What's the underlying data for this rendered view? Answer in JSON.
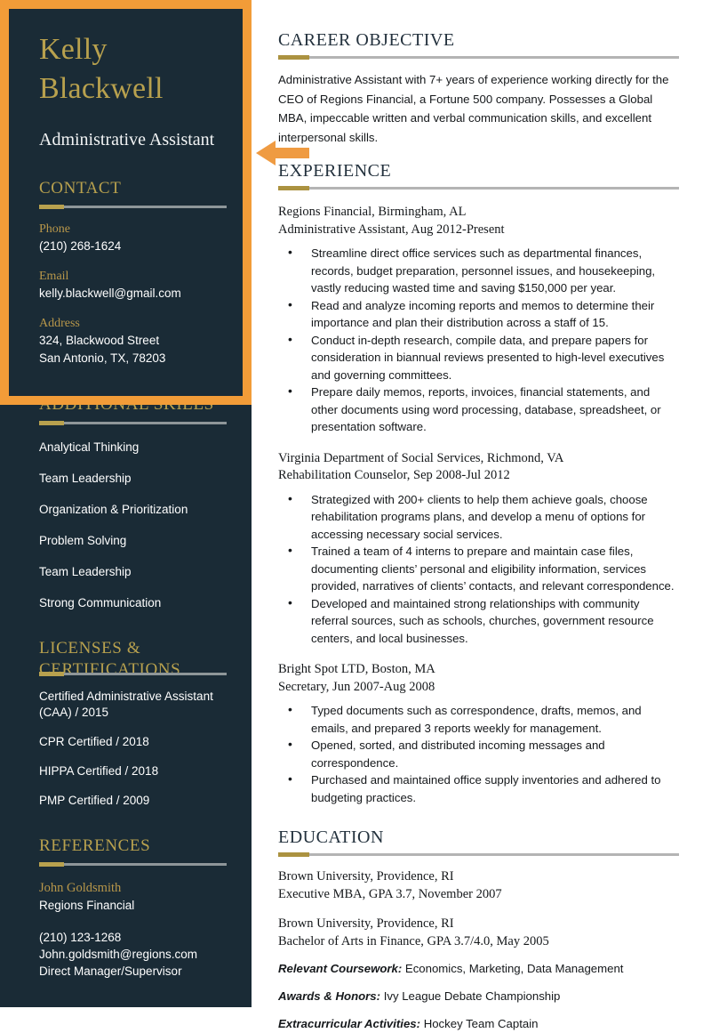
{
  "sidebar": {
    "name": "Kelly Blackwell",
    "job_title": "Administrative Assistant",
    "contact": {
      "heading": "CONTACT",
      "phone_label": "Phone",
      "phone_value": "(210) 268-1624",
      "email_label": "Email",
      "email_value": "kelly.blackwell@gmail.com",
      "address_label": "Address",
      "address_line1": "324, Blackwood Street",
      "address_line2": "San Antonio, TX, 78203"
    },
    "skills": {
      "heading": "ADDITIONAL SKILLS",
      "items": [
        "Analytical Thinking",
        "Team Leadership",
        "Organization & Prioritization",
        "Problem Solving",
        "Team Leadership",
        "Strong Communication"
      ]
    },
    "licenses": {
      "heading": "LICENSES & CERTIFICATIONS",
      "heading_line1": "LICENSES &",
      "heading_line2": "CERTIFICATIONS",
      "items": [
        "Certified Administrative Assistant (CAA) / 2015",
        "CPR Certified / 2018",
        "HIPPA Certified / 2018",
        "PMP Certified / 2009"
      ]
    },
    "references": {
      "heading": "REFERENCES",
      "ref_name": "John Goldsmith",
      "ref_org": "Regions Financial",
      "ref_phone": "(210) 123-1268",
      "ref_email": "John.goldsmith@regions.com",
      "ref_relation": "Direct Manager/Supervisor"
    }
  },
  "main": {
    "objective": {
      "heading": "CAREER OBJECTIVE",
      "text": "Administrative Assistant with 7+ years of experience working directly for the CEO of Regions Financial, a Fortune 500 company. Possesses a Global MBA, impeccable written and verbal communication skills, and excellent interpersonal skills."
    },
    "experience": {
      "heading": "EXPERIENCE",
      "jobs": [
        {
          "company": "Regions Financial, Birmingham, AL",
          "role": "Administrative Assistant, Aug 2012-Present",
          "bullets": [
            "Streamline direct office services such as departmental finances, records, budget preparation, personnel issues, and housekeeping, vastly reducing wasted time and saving $150,000 per year.",
            "Read and analyze incoming reports and memos to determine their importance and plan their distribution across a staff of 15.",
            "Conduct in-depth research, compile data, and prepare papers for consideration in biannual reviews presented to high-level executives and governing committees.",
            "Prepare daily memos, reports, invoices, financial statements, and other documents using word processing, database, spreadsheet, or presentation software."
          ]
        },
        {
          "company": "Virginia Department of Social Services, Richmond, VA",
          "role": "Rehabilitation Counselor, Sep 2008-Jul 2012",
          "bullets": [
            "Strategized with 200+ clients to help them achieve goals, choose rehabilitation programs plans, and develop a menu of options for accessing necessary social services.",
            "Trained a team of 4 interns to prepare and maintain case files, documenting clients’ personal and eligibility information, services provided, narratives of clients’ contacts, and relevant correspondence.",
            "Developed and maintained strong relationships with community referral sources, such as schools, churches, government resource centers, and local businesses."
          ]
        },
        {
          "company": "Bright Spot LTD, Boston, MA",
          "role": "Secretary, Jun 2007-Aug 2008",
          "bullets": [
            "Typed documents such as correspondence, drafts, memos, and emails, and prepared 3 reports weekly for management.",
            "Opened, sorted, and distributed incoming messages and correspondence.",
            "Purchased and maintained office supply inventories and adhered to budgeting practices."
          ]
        }
      ]
    },
    "education": {
      "heading": "EDUCATION",
      "entries": [
        {
          "school": "Brown University, Providence, RI",
          "degree": "Executive MBA, GPA 3.7, November 2007"
        },
        {
          "school": "Brown University, Providence, RI",
          "degree": "Bachelor of Arts in Finance, GPA 3.7/4.0, May 2005"
        }
      ],
      "extras": [
        {
          "label": "Relevant Coursework:",
          "value": " Economics, Marketing, Data Management"
        },
        {
          "label": "Awards & Honors:",
          "value": " Ivy League Debate Championship"
        },
        {
          "label": "Extracurricular Activities:",
          "value": " Hockey Team Captain"
        }
      ]
    }
  },
  "annotation": {
    "highlight_color": "#f29c38",
    "arrow_color": "#ef9b42",
    "arrow_direction": "left"
  },
  "theme": {
    "sidebar_bg": "#1a2b36",
    "gold": "#b8a14e",
    "heading_dark": "#23313d",
    "body_text": "#15181b"
  }
}
